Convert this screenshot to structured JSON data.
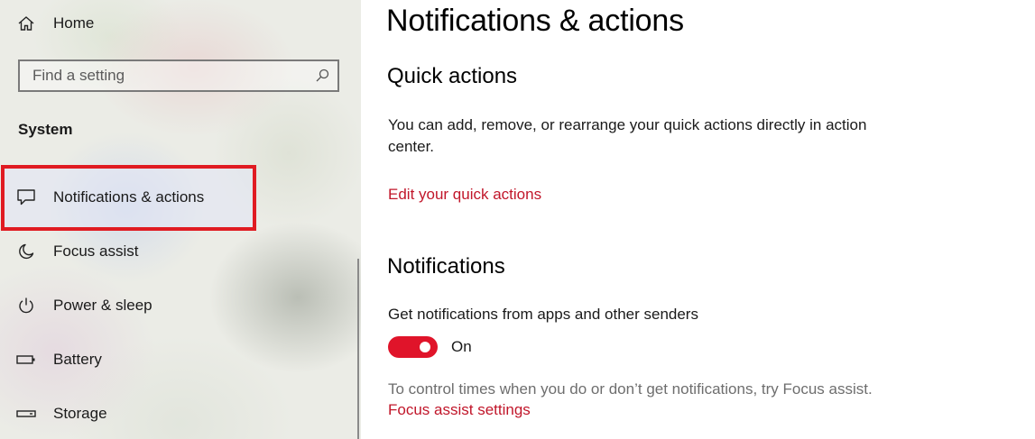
{
  "sidebar": {
    "home_label": "Home",
    "search": {
      "placeholder": "Find a setting"
    },
    "section_label": "System",
    "items": [
      {
        "label": "Notifications & actions",
        "icon": "message-icon"
      },
      {
        "label": "Focus assist",
        "icon": "moon-icon"
      },
      {
        "label": "Power & sleep",
        "icon": "power-icon"
      },
      {
        "label": "Battery",
        "icon": "battery-icon"
      },
      {
        "label": "Storage",
        "icon": "storage-icon"
      }
    ]
  },
  "main": {
    "title": "Notifications & actions",
    "quick_actions": {
      "heading": "Quick actions",
      "description": "You can add, remove, or rearrange your quick actions directly in action center.",
      "link": "Edit your quick actions"
    },
    "notifications": {
      "heading": "Notifications",
      "toggle_label": "Get notifications from apps and other senders",
      "toggle_state": "On",
      "hint": "To control times when you do or don’t get notifications, try Focus assist.",
      "link": "Focus assist settings"
    }
  },
  "colors": {
    "accent": "#e0142a",
    "link": "#c1162a",
    "highlight_border": "#e01b22"
  }
}
